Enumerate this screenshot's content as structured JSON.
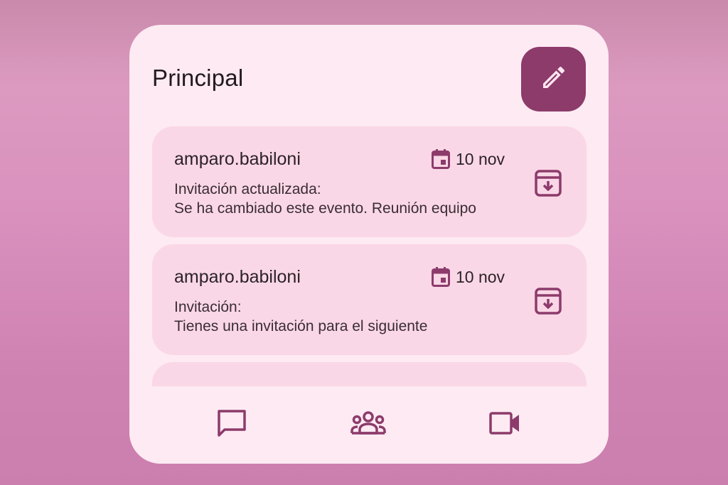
{
  "header": {
    "title": "Principal"
  },
  "icons": {
    "compose": "pencil-icon",
    "date": "calendar-icon",
    "archive": "archive-icon",
    "chat": "chat-icon",
    "spaces": "group-icon",
    "meet": "video-icon"
  },
  "colors": {
    "background": "#d990bd",
    "widget": "#fdeaf2",
    "card": "#fad7e6",
    "accent": "#8c3b6b",
    "text": "#231a1f"
  },
  "messages": [
    {
      "sender": "amparo.babiloni",
      "date": "10 nov",
      "line1": "Invitación actualizada:",
      "line2": "Se ha cambiado este evento. Reunión equipo"
    },
    {
      "sender": "amparo.babiloni",
      "date": "10 nov",
      "line1": "Invitación:",
      "line2": "Tienes una invitación para el siguiente"
    }
  ]
}
